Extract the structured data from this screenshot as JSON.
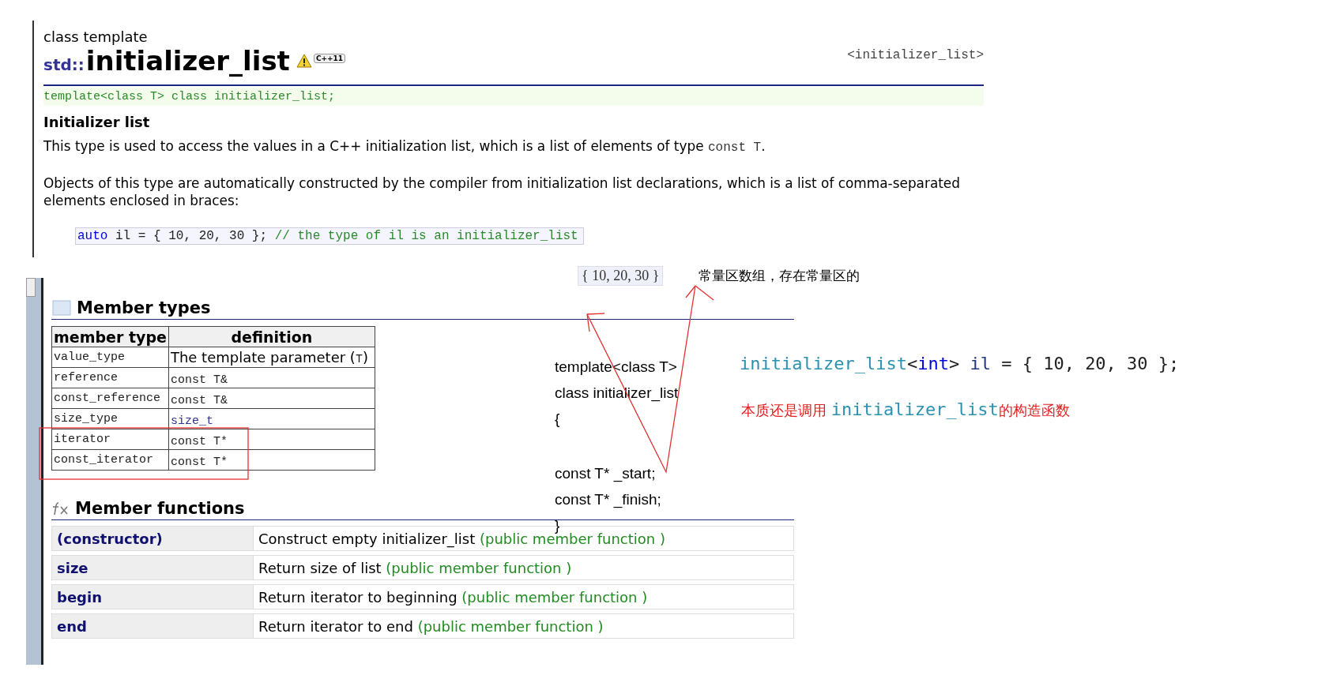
{
  "header": {
    "kind_label": "class template",
    "namespace": "std::",
    "title": "initializer_list",
    "badge": "C++11",
    "header_file": "<initializer_list>"
  },
  "declaration": "template<class T> class initializer_list;",
  "section_title": "Initializer list",
  "paragraphs": [
    [
      {
        "text": "This type is used to access the values in a C++ initialization list, which is a list of elements of type ",
        "kind": "text"
      },
      {
        "text": "const T",
        "kind": "code"
      },
      {
        "text": ".",
        "kind": "text"
      }
    ],
    [
      {
        "text": "Objects of this type are automatically constructed by the compiler from initialization list declarations, which is a list of comma-separated elements enclosed in braces:",
        "kind": "text"
      }
    ]
  ],
  "example": [
    {
      "text": "auto",
      "kind": "keyword"
    },
    {
      "text": " il = { 10, 20, 30 };  ",
      "kind": "plain"
    },
    {
      "text": "// the type of il is an initializer_list",
      "kind": "comment"
    }
  ],
  "member_types": {
    "title": "Member types",
    "columns": [
      "member type",
      "definition"
    ],
    "rows": [
      {
        "name": "value_type",
        "definition": [
          {
            "text": "The template parameter (",
            "kind": "text"
          },
          {
            "text": "T",
            "kind": "code"
          },
          {
            "text": ")",
            "kind": "text"
          }
        ]
      },
      {
        "name": "reference",
        "definition": [
          {
            "text": "const T&",
            "kind": "code"
          }
        ]
      },
      {
        "name": "const_reference",
        "definition": [
          {
            "text": "const T&",
            "kind": "code"
          }
        ]
      },
      {
        "name": "size_type",
        "definition": [
          {
            "text": "size_t",
            "kind": "link"
          }
        ]
      },
      {
        "name": "iterator",
        "definition": [
          {
            "text": "const T*",
            "kind": "code"
          }
        ]
      },
      {
        "name": "const_iterator",
        "definition": [
          {
            "text": "const T*",
            "kind": "code"
          }
        ]
      }
    ]
  },
  "member_functions": {
    "title": "Member functions",
    "rows": [
      {
        "name": "(constructor)",
        "description": "Construct empty initializer_list",
        "tag": "(public member function )"
      },
      {
        "name": "size",
        "description": "Return size of list",
        "tag": "(public member function )"
      },
      {
        "name": "begin",
        "description": "Return iterator to beginning",
        "tag": "(public member function )"
      },
      {
        "name": "end",
        "description": "Return iterator to end",
        "tag": "(public member function )"
      }
    ]
  },
  "annotations": {
    "snippet": "{ 10, 20, 30 }",
    "note": "常量区数组，存在常量区的",
    "class_sketch": [
      {
        "text": "template<class T>",
        "kind": "line"
      },
      {
        "text": "class initializer_list",
        "kind": "line"
      },
      {
        "text": "{",
        "kind": "line"
      },
      {
        "text": "const T* _start;",
        "kind": "spaced"
      },
      {
        "text": "const T* _finish;",
        "kind": "line"
      },
      {
        "text": "}",
        "kind": "line"
      }
    ],
    "code_line": [
      {
        "text": "initializer_list",
        "kind": "type"
      },
      {
        "text": "<",
        "kind": "plain"
      },
      {
        "text": "int",
        "kind": "keyword"
      },
      {
        "text": "> ",
        "kind": "plain"
      },
      {
        "text": "il",
        "kind": "variable"
      },
      {
        "text": " = { 10, 20, 30 };",
        "kind": "plain"
      }
    ],
    "explanation": [
      {
        "text": "本质还是调用 ",
        "kind": "note"
      },
      {
        "text": "initializer_list",
        "kind": "type"
      },
      {
        "text": "的构造函数",
        "kind": "note"
      }
    ]
  }
}
